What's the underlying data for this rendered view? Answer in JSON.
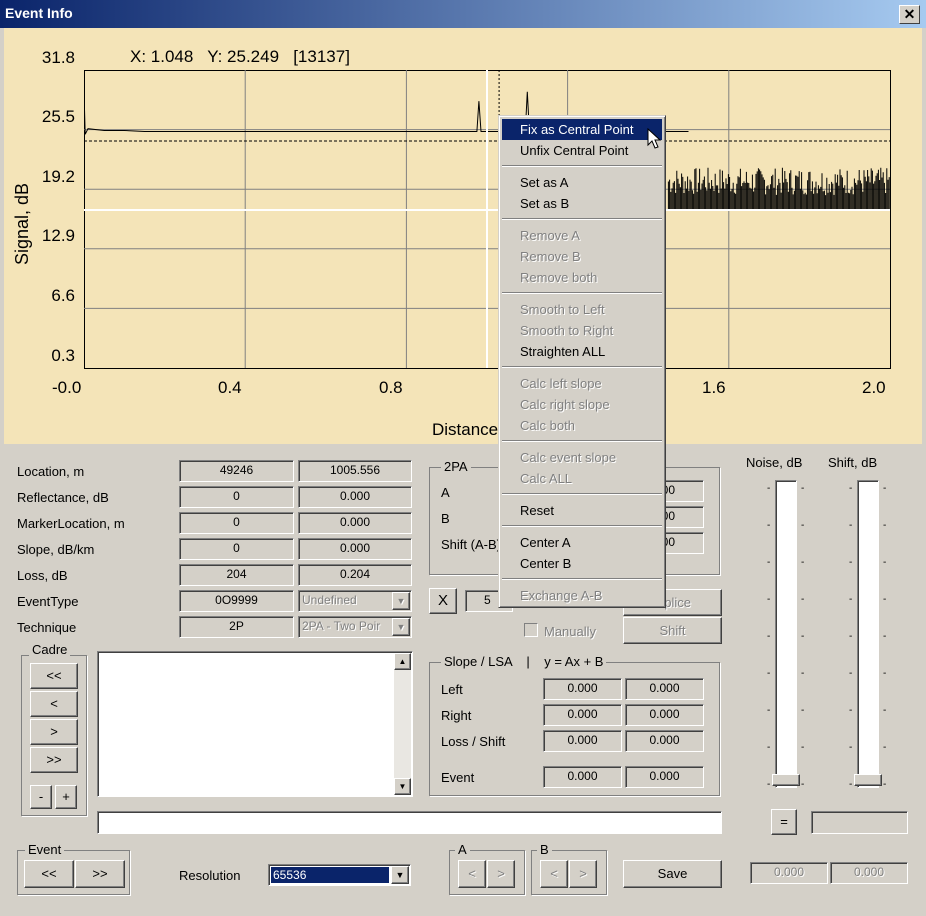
{
  "window": {
    "title": "Event Info",
    "close": "✕"
  },
  "chart": {
    "readout": "X: 1.048   Y: 25.249   [13137]",
    "ylabel": "Signal, dB",
    "xlabel": "Distance",
    "yticks": [
      "31.8",
      "25.5",
      "19.2",
      "12.9",
      "6.6",
      "0.3"
    ],
    "xticks": [
      "-0.0",
      "0.4",
      "0.8",
      "1.2",
      "1.6",
      "2.0"
    ]
  },
  "chart_data": {
    "type": "line",
    "title": "",
    "xlabel": "Distance",
    "ylabel": "Signal, dB",
    "xlim": [
      0.0,
      2.0
    ],
    "ylim": [
      0.3,
      31.8
    ],
    "x_ticks": [
      0.0,
      0.4,
      0.8,
      1.2,
      1.6,
      2.0
    ],
    "y_ticks": [
      0.3,
      6.6,
      12.9,
      19.2,
      25.5,
      31.8
    ],
    "series": [
      {
        "x": [
          0.0,
          0.003,
          0.01,
          0.05,
          0.1,
          0.15,
          0.3,
          0.5,
          0.7,
          0.9,
          0.975,
          0.98,
          0.985,
          0.99,
          1.0,
          1.095,
          1.1,
          1.105,
          1.11,
          1.15,
          1.3,
          1.4,
          1.5
        ],
        "y": [
          29.5,
          25.0,
          25.6,
          25.4,
          25.4,
          25.3,
          25.3,
          25.3,
          25.3,
          25.3,
          25.3,
          28.5,
          25.3,
          25.3,
          25.3,
          25.3,
          29.5,
          25.5,
          25.3,
          25.3,
          25.3,
          25.3,
          25.3
        ]
      }
    ],
    "reference_lines": [
      {
        "y": 24.3,
        "style": "dashed"
      },
      {
        "y": 17.0,
        "style": "solid",
        "color": "#ffffff"
      }
    ],
    "cursors": [
      {
        "x": 1.0,
        "color": "#ffffff"
      },
      {
        "x": 1.03,
        "style": "dotted"
      }
    ],
    "noise_region": {
      "x_start": 1.45,
      "x_end": 2.0,
      "y_low": 17.0,
      "y_high": 21.5
    }
  },
  "menu": {
    "items": [
      {
        "label": "Fix as Central Point",
        "enabled": true,
        "selected": true
      },
      {
        "label": "Unfix Central Point",
        "enabled": true
      },
      {
        "sep": true
      },
      {
        "label": "Set as A",
        "enabled": true
      },
      {
        "label": "Set as B",
        "enabled": true
      },
      {
        "sep": true
      },
      {
        "label": "Remove A",
        "enabled": false
      },
      {
        "label": "Remove B",
        "enabled": false
      },
      {
        "label": "Remove both",
        "enabled": false
      },
      {
        "sep": true
      },
      {
        "label": "Smooth to Left",
        "enabled": false
      },
      {
        "label": "Smooth to Right",
        "enabled": false
      },
      {
        "label": "Straighten ALL",
        "enabled": true
      },
      {
        "sep": true
      },
      {
        "label": "Calc left slope",
        "enabled": false
      },
      {
        "label": "Calc right slope",
        "enabled": false
      },
      {
        "label": "Calc both",
        "enabled": false
      },
      {
        "sep": true
      },
      {
        "label": "Calc event slope",
        "enabled": false
      },
      {
        "label": "Calc ALL",
        "enabled": false
      },
      {
        "sep": true
      },
      {
        "label": "Reset",
        "enabled": true
      },
      {
        "sep": true
      },
      {
        "label": "Center A",
        "enabled": true
      },
      {
        "label": "Center B",
        "enabled": true
      },
      {
        "sep": true
      },
      {
        "label": "Exchange A-B",
        "enabled": false
      }
    ]
  },
  "info": {
    "location": {
      "label": "Location, m",
      "v1": "49246",
      "v2": "1005.556"
    },
    "reflectance": {
      "label": "Reflectance, dB",
      "v1": "0",
      "v2": "0.000"
    },
    "marker": {
      "label": "MarkerLocation, m",
      "v1": "0",
      "v2": "0.000"
    },
    "slope": {
      "label": "Slope, dB/km",
      "v1": "0",
      "v2": "0.000"
    },
    "loss": {
      "label": "Loss, dB",
      "v1": "204",
      "v2": "0.204"
    },
    "eventtype": {
      "label": "EventType",
      "v1": "0O9999",
      "v2": "Undefined"
    },
    "technique": {
      "label": "Technique",
      "v1": "2P",
      "v2": "2PA - Two Poir"
    }
  },
  "twopa": {
    "title": "2PA",
    "a": "A",
    "b": "B",
    "shift": "Shift (A-B)",
    "va": "000",
    "vb": "000",
    "vs": "000"
  },
  "midrow": {
    "x_btn": "X",
    "num": "5",
    "splice": "plice",
    "manually": "Manually",
    "shift": "Shift"
  },
  "cadre": {
    "title": "Cadre",
    "b1": "<<",
    "b2": "<",
    "b3": ">",
    "b4": ">>",
    "minus": "-",
    "plus": "+"
  },
  "slope_lsa": {
    "title": "Slope / LSA    |    y = Ax + B",
    "rows": [
      {
        "label": "Left",
        "a": "0.000",
        "b": "0.000"
      },
      {
        "label": "Right",
        "a": "0.000",
        "b": "0.000"
      },
      {
        "label": "Loss / Shift",
        "a": "0.000",
        "b": "0.000"
      },
      {
        "label": "Event",
        "a": "0.000",
        "b": "0.000"
      }
    ]
  },
  "sliders": {
    "noise": "Noise, dB",
    "shift": "Shift, dB",
    "eq": "=",
    "v1": "0.000",
    "v2": "0.000"
  },
  "bottom": {
    "event": "Event",
    "prev": "<<",
    "next": ">>",
    "resolution": "Resolution",
    "res_value": "65536",
    "a": "A",
    "b": "B",
    "left": "<",
    "right": ">",
    "save": "Save"
  }
}
